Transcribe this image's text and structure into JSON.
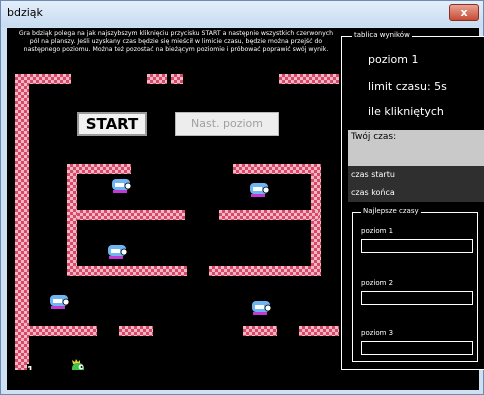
{
  "window": {
    "title": "bdziąk",
    "close_glyph": "x"
  },
  "game": {
    "instructions": "Gra bdziąk polega na jak najszybszym kliknięciu przycisku START a następnie wszystkich czerwonych pól na planszy. Jeśli uzyskany czas będzie się mieścił w limicie czasu, będzie można przejść do następnego poziomu. Można też pozostać na bieżącym poziomie i próbować poprawić swój wynik.",
    "start_label": "START",
    "next_level_label": "Nast. poziom",
    "counter": "1",
    "enemy_icon": "bubble-bobble-enemy",
    "player_icon": "bubble-dragon",
    "colors": {
      "wall_light": "#f3b7c0",
      "wall_dark": "#d8486c",
      "background": "#000000",
      "enemy_body": "#6fb5f2",
      "player_body": "#3ec446"
    }
  },
  "panel": {
    "legend": "tablica wyników",
    "level": "poziom 1",
    "time_limit": "limit czasu: 5s",
    "clicks": "ile klikniętych",
    "your_time_label": "Twój czas:",
    "start_time_label": "czas startu",
    "end_time_label": "czas końca",
    "best_legend": "Najlepsze czasy",
    "levels": [
      "poziom 1",
      "poziom 2",
      "poziom 3"
    ]
  }
}
